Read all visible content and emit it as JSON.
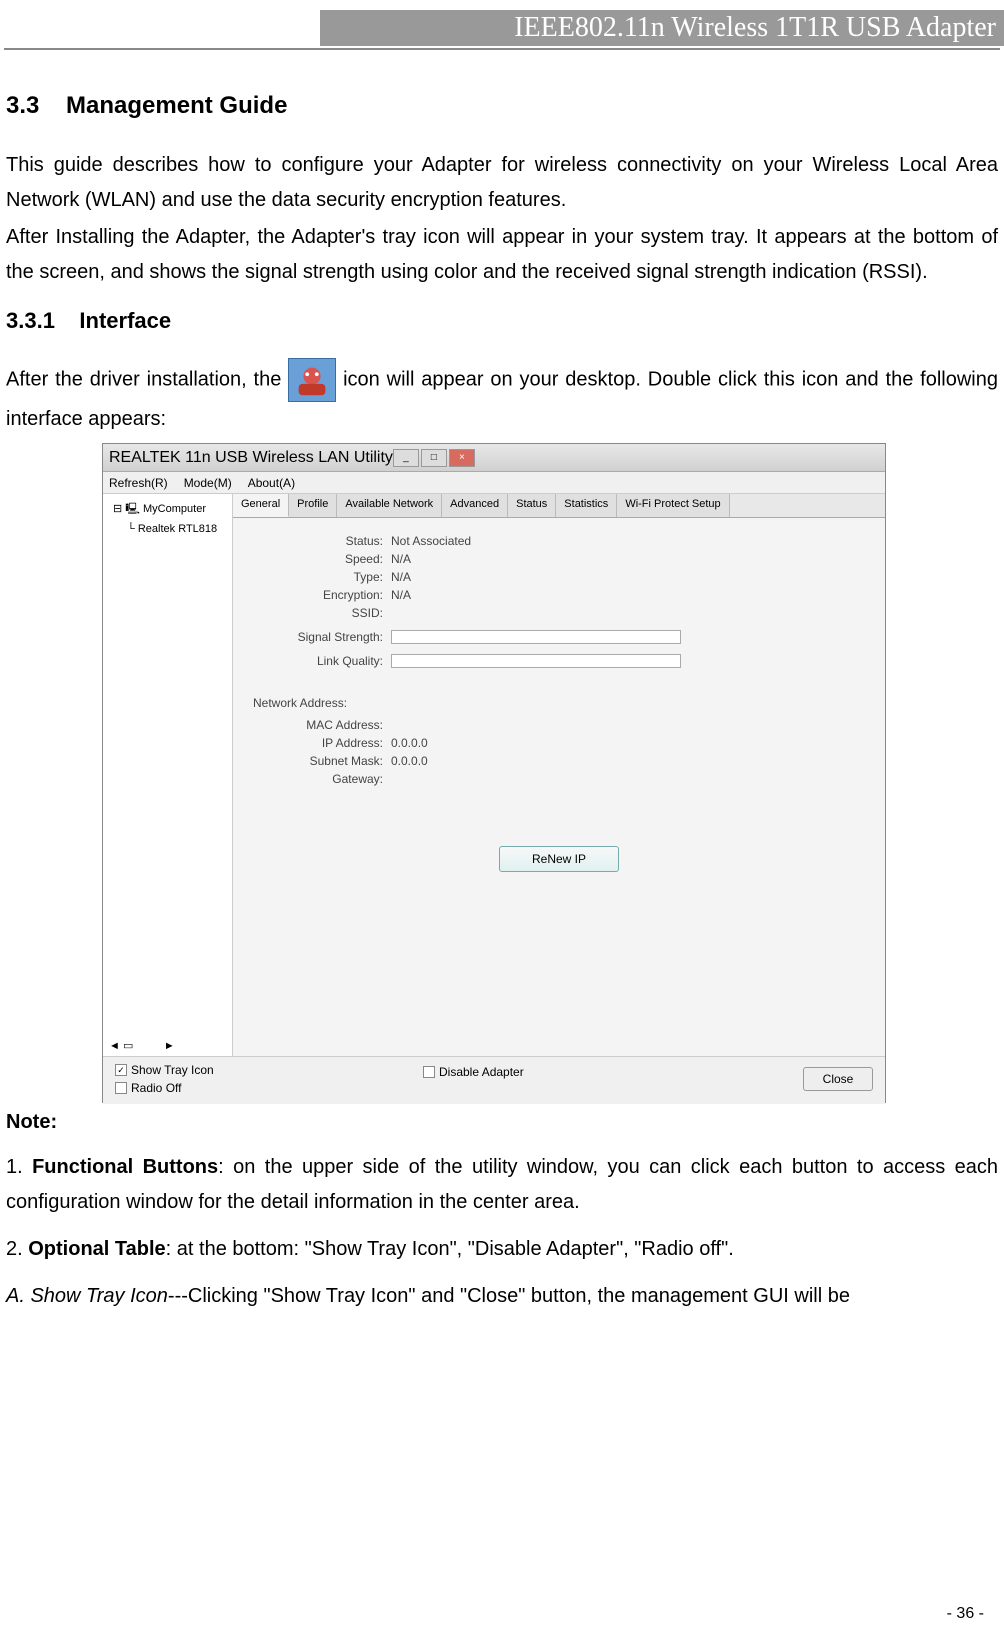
{
  "header": {
    "title": "IEEE802.11n Wireless 1T1R USB Adapter"
  },
  "section": {
    "num": "3.3",
    "title": "Management Guide"
  },
  "intro_para1": "This guide describes how to configure your Adapter for wireless connectivity on your Wireless Local Area Network (WLAN) and use the data security encryption features.",
  "intro_para2": "After Installing the Adapter, the Adapter's tray icon will appear in your system tray. It appears at the bottom of the screen, and shows the signal strength using color and the received signal strength indication (RSSI).",
  "subsection": {
    "num": "3.3.1",
    "title": "Interface"
  },
  "interface_para_a": "After the driver installation, the ",
  "interface_para_b": " icon will appear on your desktop. Double click this icon and the following interface appears:",
  "app": {
    "title": "REALTEK 11n USB Wireless LAN Utility",
    "menu": [
      "Refresh(R)",
      "Mode(M)",
      "About(A)"
    ],
    "tree": {
      "root": "MyComputer",
      "child": "Realtek RTL818"
    },
    "tabs": [
      "General",
      "Profile",
      "Available Network",
      "Advanced",
      "Status",
      "Statistics",
      "Wi-Fi Protect Setup"
    ],
    "info": {
      "status_l": "Status:",
      "status_v": "Not Associated",
      "speed_l": "Speed:",
      "speed_v": "N/A",
      "type_l": "Type:",
      "type_v": "N/A",
      "enc_l": "Encryption:",
      "enc_v": "N/A",
      "ssid_l": "SSID:",
      "ssid_v": "",
      "sig_l": "Signal Strength:",
      "link_l": "Link Quality:"
    },
    "net": {
      "title": "Network Address:",
      "mac_l": "MAC Address:",
      "mac_v": "",
      "ip_l": "IP Address:",
      "ip_v": "0.0.0.0",
      "sub_l": "Subnet Mask:",
      "sub_v": "0.0.0.0",
      "gw_l": "Gateway:",
      "gw_v": ""
    },
    "renew": "ReNew IP",
    "opts": {
      "show_tray": "Show Tray Icon",
      "radio_off": "Radio Off",
      "disable": "Disable Adapter",
      "close": "Close"
    }
  },
  "note": "Note:",
  "list1_a": "1. ",
  "list1_b": "Functional Buttons",
  "list1_c": ": on the upper side of the utility window, you can click each button to access each configuration window for the detail information in the center area.",
  "list2_a": "2. ",
  "list2_b": "Optional Table",
  "list2_c": ": at the bottom: \"Show Tray Icon\", \"Disable Adapter\", \"Radio off\".",
  "list3_a": "A. Show Tray Icon",
  "list3_b": "---Clicking \"Show Tray Icon\" and \"Close\" button, the management GUI will be",
  "page_num": "- 36 -"
}
